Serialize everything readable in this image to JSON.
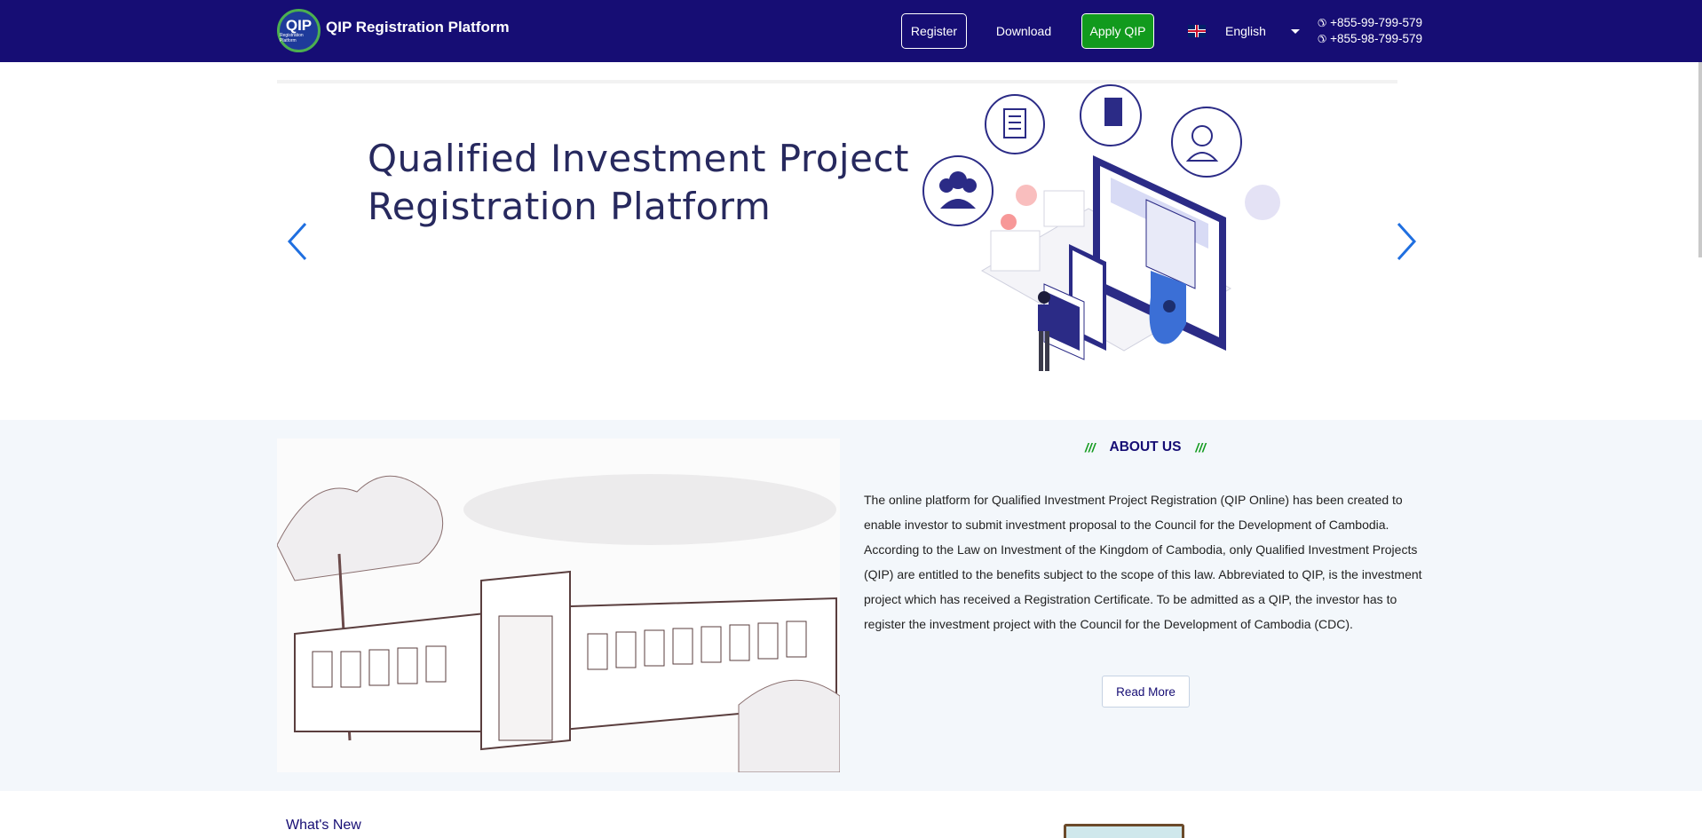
{
  "navbar": {
    "logo_text": "QIP",
    "logo_subtext": "Registration Platform",
    "title": "QIP Registration Platform",
    "register_label": "Register",
    "download_label": "Download",
    "apply_label": "Apply QIP",
    "language": "English",
    "phones": [
      "+855-99-799-579",
      "+855-98-799-579"
    ],
    "colors": {
      "background": "#160d74",
      "apply": "#119a1d"
    }
  },
  "hero": {
    "title_line1": "Qualified Investment Project",
    "title_line2": "Registration Platform"
  },
  "about": {
    "heading": "ABOUT US",
    "slash": "///",
    "text": "The online platform for Qualified Investment Project Registration (QIP Online) has been created to enable investor to submit investment proposal to the Council for the Development of Cambodia. According to the Law on Investment of the Kingdom of Cambodia, only Qualified Investment Projects (QIP) are entitled to the benefits subject to the scope of this law. Abbreviated to QIP, is the investment project which has received a Registration Certificate. To be admitted as a QIP, the investor has to register the investment project with the Council for the Development of Cambodia (CDC).",
    "read_more": "Read More"
  },
  "whats_new": {
    "title": "What's New"
  }
}
